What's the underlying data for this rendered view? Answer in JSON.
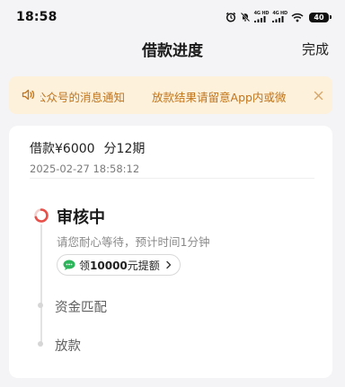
{
  "status_bar": {
    "time": "18:58",
    "net1": "4G HD",
    "net2": "4G HD",
    "battery": "40",
    "icons": [
      "alarm-icon",
      "mute-icon",
      "signal-icon",
      "signal-icon",
      "wifi-icon",
      "battery-icon"
    ]
  },
  "nav": {
    "title": "借款进度",
    "done": "完成"
  },
  "notice": {
    "text_a": "公众号的消息通知",
    "text_b": "放款结果请留意App内或微",
    "icon": "speaker-icon",
    "close_icon": "close-icon",
    "text_color": "#c0741b",
    "bg_color": "#fdf1dc"
  },
  "loan": {
    "amount": "借款¥6000",
    "term": "分12期",
    "time": "2025-02-27 18:58:12"
  },
  "progress": {
    "active": {
      "title": "审核中",
      "desc": "请您耐心等待，预计时间1分钟",
      "chip_prefix": "领",
      "chip_amount": "10000",
      "chip_suffix": "元提额",
      "accent_color": "#e8504a",
      "chip_icon_color": "#2cb55a"
    },
    "steps": [
      {
        "title": "资金匹配"
      },
      {
        "title": "放款"
      }
    ]
  }
}
